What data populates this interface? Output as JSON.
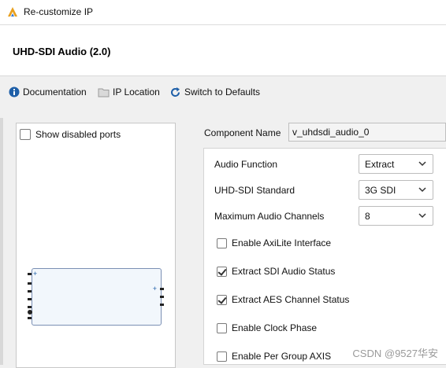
{
  "window": {
    "title": "Re-customize IP",
    "logo_icon": "vivado-logo-icon"
  },
  "header": {
    "ip_title": "UHD-SDI Audio (2.0)"
  },
  "toolbar": {
    "documentation": "Documentation",
    "ip_location": "IP Location",
    "switch_defaults": "Switch to Defaults"
  },
  "left_panel": {
    "show_disabled_ports": "Show disabled ports",
    "show_disabled_checked": false
  },
  "component": {
    "label": "Component Name",
    "value": "v_uhdsdi_audio_0"
  },
  "fields": [
    {
      "label": "Audio Function",
      "value": "Extract"
    },
    {
      "label": "UHD-SDI Standard",
      "value": "3G SDI"
    },
    {
      "label": "Maximum Audio Channels",
      "value": "8"
    }
  ],
  "checkboxes": [
    {
      "label": "Enable AxiLite Interface",
      "checked": false
    },
    {
      "label": "Extract SDI Audio Status",
      "checked": true
    },
    {
      "label": "Extract AES Channel Status",
      "checked": true
    },
    {
      "label": "Enable Clock Phase",
      "checked": false
    },
    {
      "label": "Enable Per Group AXIS",
      "checked": false
    }
  ],
  "watermark": "CSDN @9527华安",
  "colors": {
    "accent_blue": "#1e5fa8",
    "logo_orange": "#e8a020"
  }
}
